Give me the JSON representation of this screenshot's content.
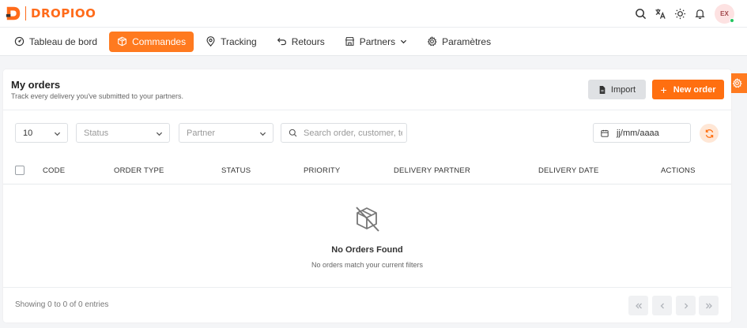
{
  "brand": {
    "name": "DROPIOO",
    "accent": "#ff6b1a"
  },
  "header": {
    "icons": [
      "search-icon",
      "translate-icon",
      "sun-icon",
      "bell-icon"
    ],
    "avatar_initials": "EX"
  },
  "nav": {
    "items": [
      {
        "label": "Tableau de bord",
        "icon": "dashboard-icon",
        "active": false
      },
      {
        "label": "Commandes",
        "icon": "box-icon",
        "active": true
      },
      {
        "label": "Tracking",
        "icon": "map-pin-icon",
        "active": false
      },
      {
        "label": "Retours",
        "icon": "return-icon",
        "active": false
      },
      {
        "label": "Partners",
        "icon": "store-icon",
        "active": false,
        "dropdown": true
      },
      {
        "label": "Paramètres",
        "icon": "gear-icon",
        "active": false
      }
    ]
  },
  "page": {
    "title": "My orders",
    "subtitle": "Track every delivery you've submitted to your partners.",
    "import_label": "Import",
    "new_order_label": "New order"
  },
  "filters": {
    "page_size": "10",
    "status_placeholder": "Status",
    "partner_placeholder": "Partner",
    "search_placeholder": "Search order, customer, te",
    "date_placeholder": "jj/mm/aaaa"
  },
  "table": {
    "columns": [
      "CODE",
      "ORDER TYPE",
      "STATUS",
      "PRIORITY",
      "DELIVERY PARTNER",
      "DELIVERY DATE",
      "ACTIONS"
    ],
    "rows": [],
    "empty_title": "No Orders Found",
    "empty_subtitle": "No orders match your current filters"
  },
  "footer": {
    "showing_text": "Showing 0 to 0 of 0 entries"
  }
}
